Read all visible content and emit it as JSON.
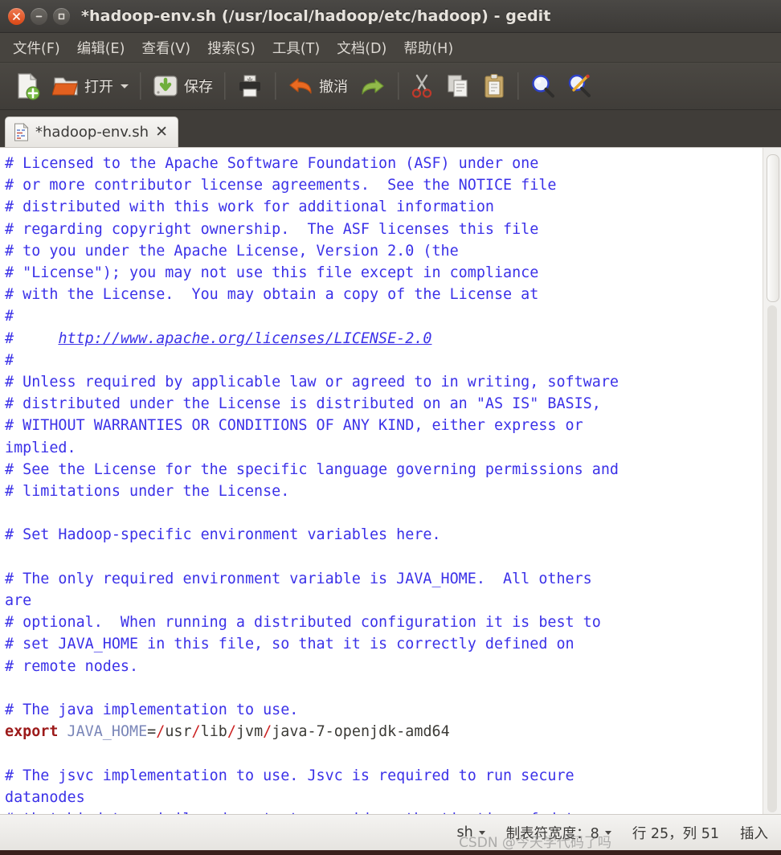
{
  "window": {
    "title": "*hadoop-env.sh (/usr/local/hadoop/etc/hadoop) - gedit",
    "controls": {
      "close": "close-button",
      "minimize": "minimize-button",
      "maximize": "maximize-button"
    }
  },
  "menubar": {
    "items": [
      {
        "label": "文件(F)"
      },
      {
        "label": "编辑(E)"
      },
      {
        "label": "查看(V)"
      },
      {
        "label": "搜索(S)"
      },
      {
        "label": "工具(T)"
      },
      {
        "label": "文档(D)"
      },
      {
        "label": "帮助(H)"
      }
    ]
  },
  "toolbar": {
    "new_label": "",
    "open_label": "打开",
    "save_label": "保存",
    "print_label": "",
    "undo_label": "撤消",
    "redo_label": "",
    "cut_label": "",
    "copy_label": "",
    "paste_label": "",
    "find_label": "",
    "replace_label": ""
  },
  "tab": {
    "title": "*hadoop-env.sh",
    "close": "✕"
  },
  "editor": {
    "lines": [
      "# Licensed to the Apache Software Foundation (ASF) under one",
      "# or more contributor license agreements.  See the NOTICE file",
      "# distributed with this work for additional information",
      "# regarding copyright ownership.  The ASF licenses this file",
      "# to you under the Apache License, Version 2.0 (the",
      "# \"License\"); you may not use this file except in compliance",
      "# with the License.  You may obtain a copy of the License at",
      "#",
      "#     http://www.apache.org/licenses/LICENSE-2.0",
      "#",
      "# Unless required by applicable law or agreed to in writing, software",
      "# distributed under the License is distributed on an \"AS IS\" BASIS,",
      "# WITHOUT WARRANTIES OR CONDITIONS OF ANY KIND, either express or",
      "implied.",
      "# See the License for the specific language governing permissions and",
      "# limitations under the License.",
      "",
      "# Set Hadoop-specific environment variables here.",
      "",
      "# The only required environment variable is JAVA_HOME.  All others",
      "are",
      "# optional.  When running a distributed configuration it is best to",
      "# set JAVA_HOME in this file, so that it is correctly defined on",
      "# remote nodes.",
      "",
      "# The java implementation to use.",
      "export JAVA_HOME=/usr/lib/jvm/java-7-openjdk-amd64",
      "",
      "# The jsvc implementation to use. Jsvc is required to run secure",
      "datanodes",
      "# that bind to privileged ports to provide authentication of data"
    ],
    "url": "http://www.apache.org/licenses/LICENSE-2.0",
    "export_keyword": "export",
    "export_var": "JAVA_HOME",
    "export_value": "/usr/lib/jvm/java-7-openjdk-amd64"
  },
  "statusbar": {
    "language": "sh",
    "tab_width": "制表符宽度：8",
    "position": "行 25，列 51",
    "insert_mode": "插入"
  },
  "watermark": {
    "text": "CSDN @今天学代码了吗"
  },
  "colors": {
    "comment": "#3b31e8",
    "keyword": "#9c1a1a",
    "variable": "#7a86b8",
    "slash": "#cc2222",
    "titlebar": "#3c3a37",
    "toolbar": "#443f3b",
    "editor_bg": "#ffffff"
  }
}
